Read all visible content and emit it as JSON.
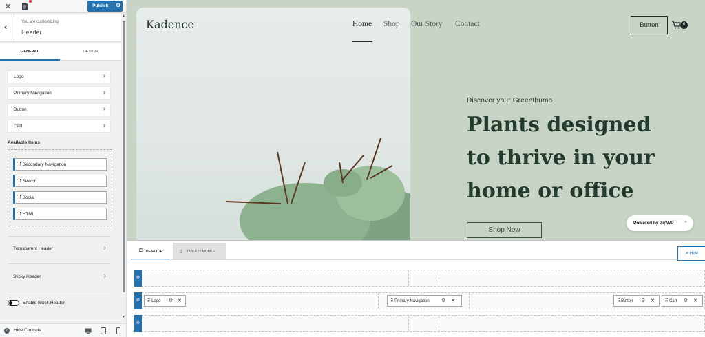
{
  "topbar": {
    "close_icon": "close-icon",
    "publish_label": "Publish"
  },
  "customizing": {
    "small": "You are customizing",
    "big": "Header"
  },
  "tabs": {
    "general": "General",
    "design": "Design"
  },
  "components": [
    {
      "label": "Logo"
    },
    {
      "label": "Primary Navigation"
    },
    {
      "label": "Button"
    },
    {
      "label": "Cart"
    }
  ],
  "available": {
    "title": "Available Items",
    "items": [
      "Secondary Navigation",
      "Search",
      "Social",
      "HTML"
    ]
  },
  "more_sections": [
    "Transparent Header",
    "Sticky Header"
  ],
  "block_header": {
    "label": "Enable Block Header",
    "enabled": false
  },
  "bottom": {
    "hide_controls": "Hide Controls"
  },
  "site": {
    "logo": "Kadence",
    "nav": [
      "Home",
      "Shop",
      "Our Story",
      "Contact"
    ],
    "active_nav": "Home",
    "header_button": "Button",
    "cart_count": "0",
    "kicker": "Discover your Greenthumb",
    "headline": [
      "Plants designed",
      "to thrive in your",
      "home or office"
    ],
    "cta": "Shop Now",
    "badge": "Powered by ZipWP",
    "badge_close": "×"
  },
  "builder": {
    "tab_desktop": "Desktop",
    "tab_tablet": "Tablet / Mobile",
    "hide_label": "Hide",
    "chips": {
      "logo": "Logo",
      "primary_nav": "Primary Navigation",
      "button": "Button",
      "cart": "Cart"
    }
  },
  "colors": {
    "accent": "#2271b1",
    "hero_bg": "#c8d5c6",
    "headline": "#233a2f"
  }
}
